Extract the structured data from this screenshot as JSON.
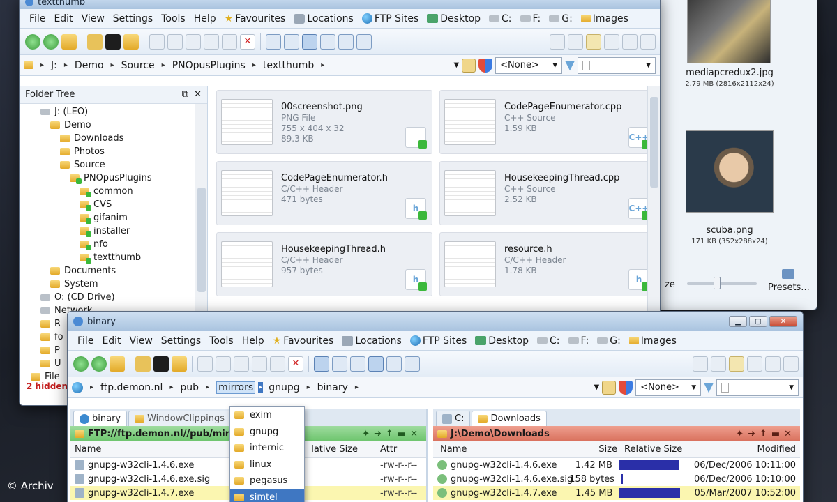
{
  "watermark": "© Archiv",
  "background_window": {
    "images": [
      {
        "name": "mediapcredux2.jpg",
        "meta": "2.79 MB (2816x2112x24)"
      },
      {
        "name": "scuba.png",
        "meta": "171 KB (352x288x24)"
      }
    ],
    "size_label": "ze",
    "presets_label": "Presets..."
  },
  "top_window": {
    "title": "textthumb",
    "menu": [
      "File",
      "Edit",
      "View",
      "Settings",
      "Tools",
      "Help",
      "Favourites",
      "Locations",
      "FTP Sites",
      "Desktop",
      "C:",
      "F:",
      "G:",
      "Images"
    ],
    "path": [
      "J:",
      "Demo",
      "Source",
      "PNOpusPlugins",
      "textthumb"
    ],
    "filter_value": "<None>",
    "folder_tree_title": "Folder Tree",
    "tree": [
      {
        "label": "J: (LEO)",
        "depth": 0
      },
      {
        "label": "Demo",
        "depth": 1
      },
      {
        "label": "Downloads",
        "depth": 2
      },
      {
        "label": "Photos",
        "depth": 2
      },
      {
        "label": "Source",
        "depth": 2
      },
      {
        "label": "PNOpusPlugins",
        "depth": 3
      },
      {
        "label": "common",
        "depth": 4
      },
      {
        "label": "CVS",
        "depth": 4
      },
      {
        "label": "gifanim",
        "depth": 4
      },
      {
        "label": "installer",
        "depth": 4
      },
      {
        "label": "nfo",
        "depth": 4
      },
      {
        "label": "textthumb",
        "depth": 4
      },
      {
        "label": "Documents",
        "depth": 1
      },
      {
        "label": "System",
        "depth": 1
      },
      {
        "label": "O: (CD Drive)",
        "depth": 0
      },
      {
        "label": "Network",
        "depth": 0
      }
    ],
    "tree_partial": [
      "R",
      "fo",
      "P",
      "U"
    ],
    "tree_bottom_label": "File",
    "hidden_text": "2 hidden",
    "files": [
      {
        "name": "00screenshot.png",
        "type": "PNG File",
        "line3": "755 x 404 x 32",
        "size": "89.3 KB",
        "badge": ""
      },
      {
        "name": "CodePageEnumerator.cpp",
        "type": "C++ Source",
        "line3": "",
        "size": "1.59 KB",
        "badge": "C++"
      },
      {
        "name": "CodePageEnumerator.h",
        "type": "C/C++ Header",
        "line3": "",
        "size": "471 bytes",
        "badge": "h"
      },
      {
        "name": "HousekeepingThread.cpp",
        "type": "C++ Source",
        "line3": "",
        "size": "2.52 KB",
        "badge": "C++"
      },
      {
        "name": "HousekeepingThread.h",
        "type": "C/C++ Header",
        "line3": "",
        "size": "957 bytes",
        "badge": "h"
      },
      {
        "name": "resource.h",
        "type": "C/C++ Header",
        "line3": "",
        "size": "1.78 KB",
        "badge": "h"
      }
    ]
  },
  "front_window": {
    "title": "binary",
    "menu": [
      "File",
      "Edit",
      "View",
      "Settings",
      "Tools",
      "Help",
      "Favourites",
      "Locations",
      "FTP Sites",
      "Desktop",
      "C:",
      "F:",
      "G:",
      "Images"
    ],
    "path": [
      "ftp.demon.nl",
      "pub",
      "mirrors",
      "gnupg",
      "binary"
    ],
    "filter_value": "<None>",
    "dropdown": [
      "exim",
      "gnupg",
      "internic",
      "linux",
      "pegasus",
      "simtel"
    ],
    "dropdown_selected": 5,
    "left": {
      "tabs": [
        "binary",
        "WindowClippings"
      ],
      "path": "FTP://ftp.demon.nl//pub/mirror",
      "columns": {
        "name": "Name",
        "size": "lative Size",
        "attr": "Attr"
      },
      "rows": [
        {
          "name": "gnupg-w32cli-1.4.6.exe",
          "attr": "-rw-r--r--"
        },
        {
          "name": "gnupg-w32cli-1.4.6.exe.sig",
          "attr": "-rw-r--r--"
        },
        {
          "name": "gnupg-w32cli-1.4.7.exe",
          "attr": "-rw-r--r--"
        }
      ]
    },
    "right": {
      "tabs": [
        "C:",
        "Downloads"
      ],
      "path": "J:\\Demo\\Downloads",
      "columns": {
        "name": "Name",
        "size": "Size",
        "relsize": "Relative Size",
        "modified": "Modified"
      },
      "rows": [
        {
          "name": "gnupg-w32cli-1.4.6.exe",
          "size": "1.42 MB",
          "modified": "06/Dec/2006 10:11:00",
          "rel": 0.95
        },
        {
          "name": "gnupg-w32cli-1.4.6.exe.sig",
          "size": "158 bytes",
          "modified": "06/Dec/2006 10:10:00",
          "rel": 0.02
        },
        {
          "name": "gnupg-w32cli-1.4.7.exe",
          "size": "1.45 MB",
          "modified": "05/Mar/2007 10:52:00",
          "rel": 0.97
        }
      ]
    }
  }
}
